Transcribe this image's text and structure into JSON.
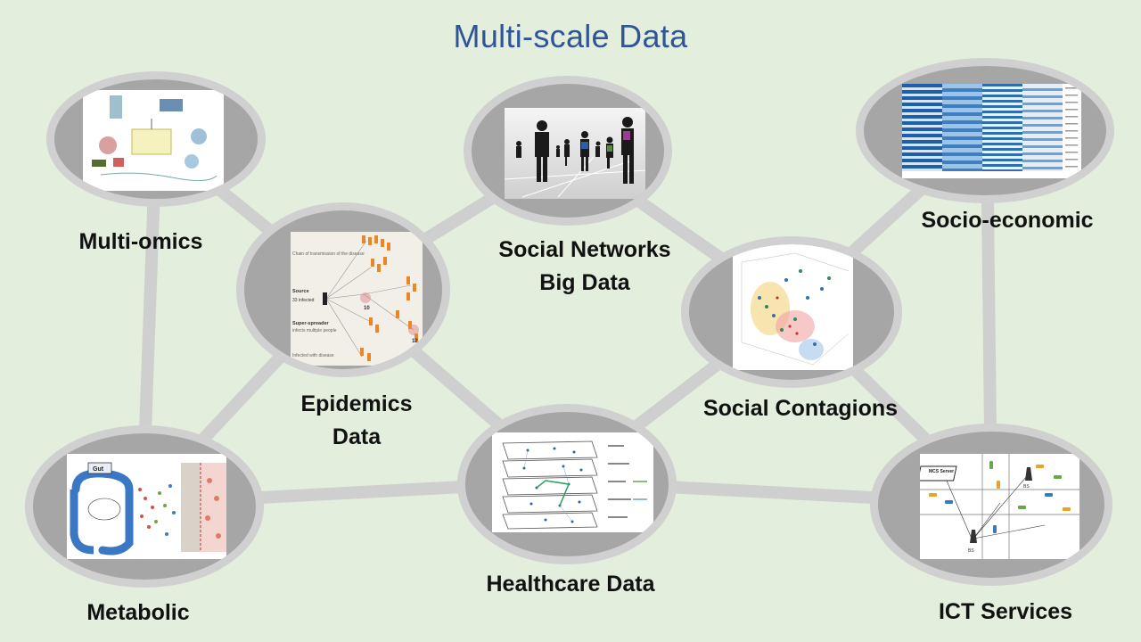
{
  "title": "Multi-scale Data",
  "nodes": [
    {
      "id": "multi-omics",
      "label": "Multi-omics",
      "icon": "multiomics-diagram-image"
    },
    {
      "id": "epidemics",
      "label_lines": [
        "Epidemics",
        "Data"
      ],
      "icon": "disease-transmission-chain-image",
      "thumb_text": {
        "chain": "Chain of transmission of the disease",
        "source": "Source",
        "infected": "33 infected",
        "super": "Super-spreader",
        "super_sub": "infects multiple people",
        "disease": "Infected with disease",
        "n10": "10",
        "n12": "12"
      }
    },
    {
      "id": "social-networks",
      "label_lines": [
        "Social Networks",
        "Big Data"
      ],
      "icon": "people-network-silhouettes-image"
    },
    {
      "id": "social-contagions",
      "label": "Social Contagions",
      "icon": "3d-scatter-plot-image"
    },
    {
      "id": "socio-economic",
      "label": "Socio-economic",
      "icon": "blue-heatmap-image"
    },
    {
      "id": "metabolic",
      "label": "Metabolic",
      "icon": "gut-metabolism-diagram-image",
      "thumb_text": {
        "gut": "Gut"
      }
    },
    {
      "id": "healthcare",
      "label": "Healthcare Data",
      "icon": "multilayer-network-image"
    },
    {
      "id": "ict",
      "label": "ICT Services",
      "icon": "mobile-crowdsensing-map-image",
      "thumb_text": {
        "server": "MCS Server",
        "bs1": "BS",
        "bs2": "BS"
      }
    }
  ],
  "colors": {
    "background": "#e3eedc",
    "title": "#2f5597",
    "node_fill": "#a6a6a6",
    "node_ring": "#d0d0d0",
    "edge": "#cfcfcf"
  }
}
